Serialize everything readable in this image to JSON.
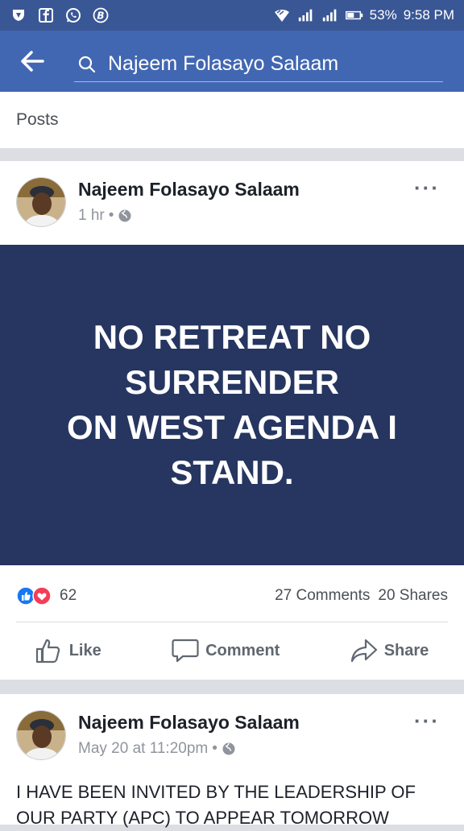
{
  "statusbar": {
    "battery": "53%",
    "time": "9:58 PM",
    "icons": [
      "vpn-icon",
      "facebook-icon",
      "whatsapp-icon",
      "b-icon",
      "wifi-icon",
      "signal-icon",
      "signal-icon",
      "battery-icon"
    ]
  },
  "topbar": {
    "search_text": "Najeem Folasayo Salaam",
    "color": "#4267b2"
  },
  "posts_header": "Posts",
  "post1": {
    "author": "Najeem Folasayo Salaam",
    "time": "1 hr",
    "banner_lines": [
      "NO RETREAT NO",
      "SURRENDER",
      "ON WEST AGENDA I",
      "STAND."
    ],
    "banner_color": "#263661",
    "reaction_count": "62",
    "comments": "27 Comments",
    "shares": "20 Shares",
    "actions": {
      "like": "Like",
      "comment": "Comment",
      "share": "Share"
    }
  },
  "post2": {
    "author": "Najeem Folasayo Salaam",
    "time": "May 20 at 11:20pm",
    "text_lines": [
      "I HAVE BEEN INVITED BY THE LEADERSHIP OF",
      "OUR PARTY  (APC) TO APPEAR TOMORROW"
    ]
  }
}
